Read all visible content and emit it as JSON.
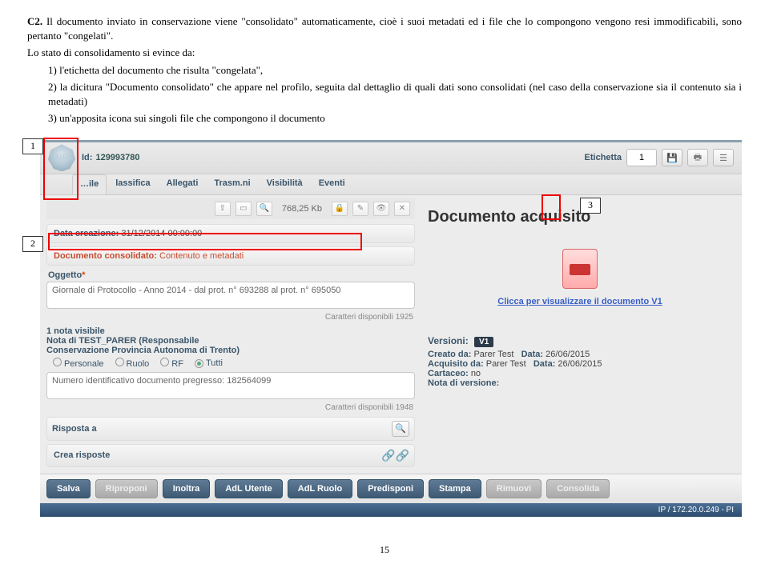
{
  "text": {
    "c2_label": "C2.",
    "c2_body": " Il documento inviato in conservazione viene \"consolidato\" automaticamente, cioè i suoi metadati ed i file che lo compongono vengono resi immodificabili, sono pertanto \"congelati\".",
    "intro2": "Lo stato di consolidamento si evince da:",
    "li1_n": "1)",
    "li1_t": "l'etichetta del documento che risulta \"congelata\",",
    "li2_n": "2)",
    "li2_t": "la dicitura \"Documento consolidato\" che appare nel profilo, seguita dal dettaglio di quali dati sono consolidati (nel caso della conservazione sia il contenuto sia i metadati)",
    "li3_n": "3)",
    "li3_t": "un'apposita icona sui singoli file che compongono il documento"
  },
  "callouts": {
    "c1": "1",
    "c2": "2",
    "c3": "3"
  },
  "topbar": {
    "np": "NP",
    "id_label": "Id:",
    "id_value": "129993780",
    "etichetta_label": "Etichetta",
    "etichetta_value": "1"
  },
  "tabs": {
    "t0": "…ile",
    "t1": "lassifica",
    "t2": "Allegati",
    "t3": "Trasm.ni",
    "t4": "Visibilità",
    "t5": "Eventi"
  },
  "filebar": {
    "size": "768,25 Kb"
  },
  "left": {
    "data_creazione_lbl": "Data creazione:",
    "data_creazione_val": "31/12/2014 00:00:00",
    "doc_cons_lbl": "Documento consolidato:",
    "doc_cons_val": "Contenuto e metadati",
    "oggetto_lbl": "Oggetto",
    "oggetto_val": "Giornale di Protocollo - Anno 2014 - dal prot. n° 693288 al prot. n° 695050",
    "char1": "Caratteri disponibili 1925",
    "note_hdr": "1 nota visibile",
    "note_sub1": "Nota di TEST_PARER (Responsabile",
    "note_sub2": "Conservazione Provincia Autonoma di Trento)",
    "r_personale": "Personale",
    "r_ruolo": "Ruolo",
    "r_rf": "RF",
    "r_tutti": "Tutti",
    "note_ta": "Numero identificativo documento pregresso: 182564099",
    "char2": "Caratteri disponibili 1948",
    "risposta_lbl": "Risposta a",
    "crea_lbl": "Crea risposte"
  },
  "right": {
    "doc_acq": "Documento acquisito",
    "pdf_link": "Clicca per visualizzare il documento V1",
    "ver_lbl": "Versioni:",
    "ver_badge": "V1",
    "l1a": "Creato da:",
    "l1b": "Parer Test",
    "l1c": "Data:",
    "l1d": "26/06/2015",
    "l2a": "Acquisito da:",
    "l2b": "Parer Test",
    "l2c": "Data:",
    "l2d": "26/06/2015",
    "l3a": "Cartaceo:",
    "l3b": "no",
    "l4a": "Nota di versione:"
  },
  "actions": {
    "b0": "Salva",
    "b1": "Riproponi",
    "b2": "Inoltra",
    "b3": "AdL Utente",
    "b4": "AdL Ruolo",
    "b5": "Predisponi",
    "b6": "Stampa",
    "b7": "Rimuovi",
    "b8": "Consolida"
  },
  "status": "IP / 172.20.0.249 - PI",
  "page_num": "15"
}
